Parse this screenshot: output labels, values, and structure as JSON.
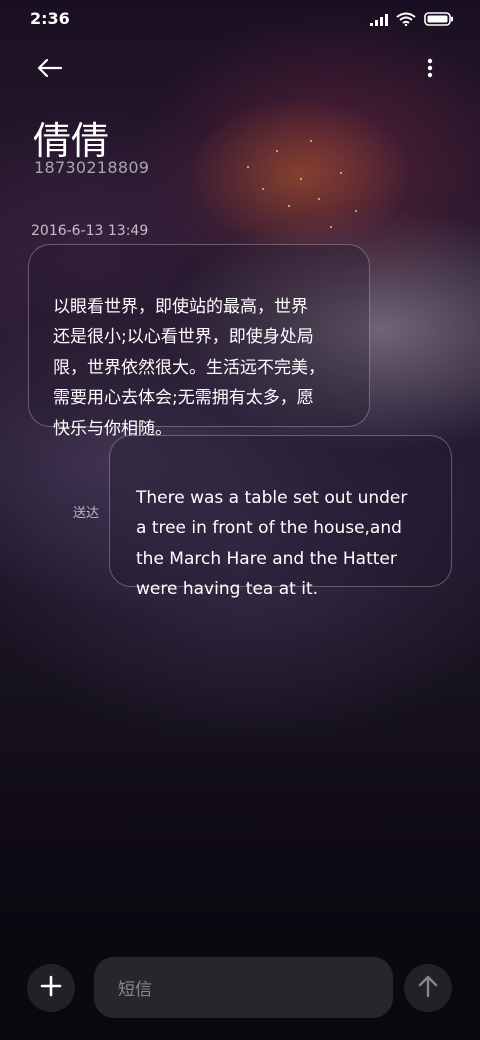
{
  "status_bar": {
    "time": "2:36",
    "icons": [
      "signal-icon",
      "wifi-icon",
      "battery-icon"
    ]
  },
  "header": {
    "back_icon": "back-arrow-icon",
    "more_icon": "more-vertical-icon",
    "contact_name": "倩倩",
    "contact_number": "18730218809"
  },
  "conversation": {
    "timestamp": "2016-6-13 13:49",
    "messages": [
      {
        "direction": "incoming",
        "text": "以眼看世界，即使站的最高，世界\n还是很小;以心看世界，即使身处局\n限，世界依然很大。生活远不完美，\n需要用心去体会;无需拥有太多，愿\n快乐与你相随。"
      },
      {
        "direction": "outgoing",
        "text": "There was a table set out under\na tree in front of the house,and\nthe March Hare and the Hatter\nwere having tea at it.",
        "status": "送达"
      }
    ]
  },
  "composer": {
    "add_icon": "plus-icon",
    "placeholder": "短信",
    "send_icon": "send-arrow-icon"
  }
}
